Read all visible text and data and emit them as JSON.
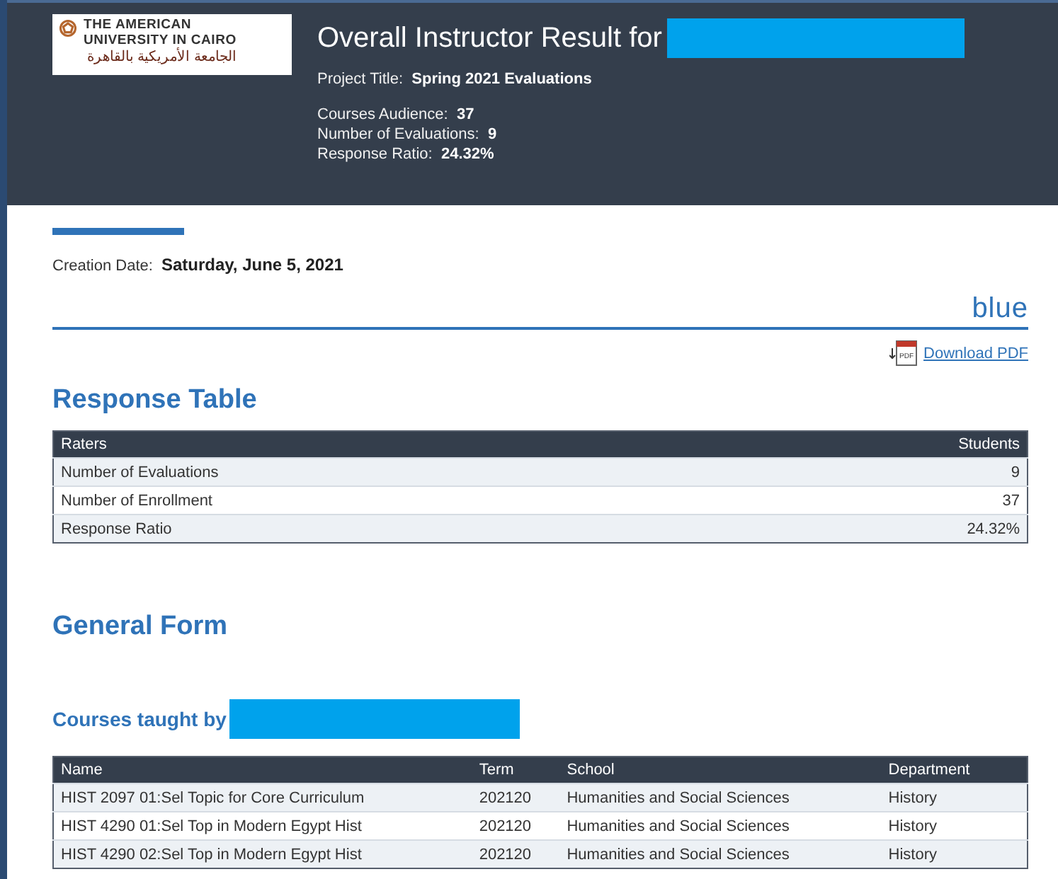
{
  "header": {
    "logo": {
      "line_1": "THE AMERICAN",
      "line_2": "UNIVERSITY IN CAIRO",
      "line_3": "الجامعة الأمريكية بالقاهرة"
    },
    "title": "Overall Instructor Result for",
    "project_title": {
      "label": "Project Title:",
      "value": "Spring 2021 Evaluations"
    },
    "stats": [
      {
        "label": "Courses Audience:",
        "value": "37"
      },
      {
        "label": "Number of Evaluations:",
        "value": "9"
      },
      {
        "label": "Response Ratio:",
        "value": "24.32%"
      }
    ]
  },
  "creation_date": {
    "label": "Creation Date:",
    "value": "Saturday, June 5, 2021"
  },
  "brand": "blue",
  "download_link": "Download PDF",
  "pdf_icon_text": "PDF",
  "response_table": {
    "heading": "Response Table",
    "columns": [
      "Raters",
      "Students"
    ],
    "rows": [
      [
        "Number of Evaluations",
        "9"
      ],
      [
        "Number of Enrollment",
        "37"
      ],
      [
        "Response Ratio",
        "24.32%"
      ]
    ]
  },
  "form_heading": "General Form",
  "courses": {
    "heading": "Courses taught by",
    "columns": [
      "Name",
      "Term",
      "School",
      "Department"
    ],
    "rows": [
      [
        "HIST 2097 01:Sel Topic for Core Curriculum",
        "202120",
        "Humanities and Social Sciences",
        "History"
      ],
      [
        "HIST 4290 01:Sel Top in Modern Egypt Hist",
        "202120",
        "Humanities and Social Sciences",
        "History"
      ],
      [
        "HIST 4290 02:Sel Top in Modern Egypt Hist",
        "202120",
        "Humanities and Social Sciences",
        "History"
      ]
    ]
  }
}
